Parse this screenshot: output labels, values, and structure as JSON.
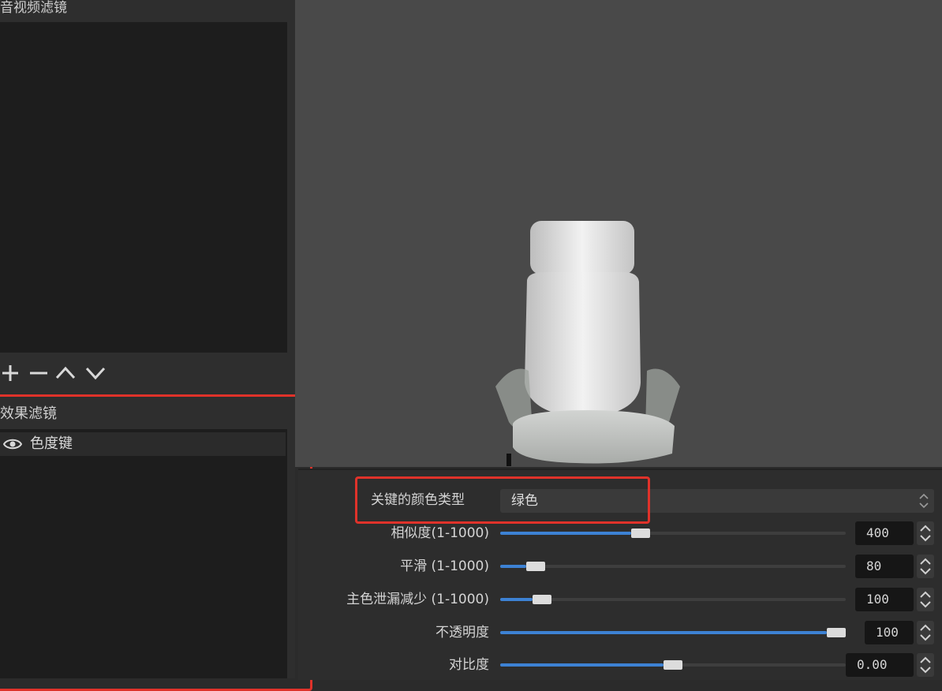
{
  "audio_video_filters": {
    "header": "音视频滤镜",
    "toolbar": {
      "add_icon": "plus-icon",
      "remove_icon": "minus-icon",
      "move_up_icon": "chevron-up-icon",
      "move_down_icon": "chevron-down-icon"
    }
  },
  "effect_filters": {
    "header": "效果滤镜",
    "items": [
      {
        "label": "色度键",
        "icon": "eye-icon",
        "visible": true
      }
    ]
  },
  "properties": {
    "key_color_type": {
      "label": "关键的颜色类型",
      "value": "绿色"
    },
    "sliders": [
      {
        "label": "相似度(1-1000)",
        "value": "400",
        "fraction": 0.4
      },
      {
        "label": "平滑 (1-1000)",
        "value": "80",
        "fraction": 0.08
      },
      {
        "label": "主色泄漏减少 (1-1000)",
        "value": "100",
        "fraction": 0.1
      },
      {
        "label": "不透明度",
        "value": "100",
        "fraction": 1.0
      },
      {
        "label": "对比度",
        "value": "0.00",
        "fraction": 0.5
      }
    ]
  },
  "colors": {
    "accent": "#3d82d4",
    "highlight": "#e0322a",
    "preview_bg": "#494949",
    "panel_bg": "#2d2d2d",
    "list_bg": "#1d1d1d"
  }
}
